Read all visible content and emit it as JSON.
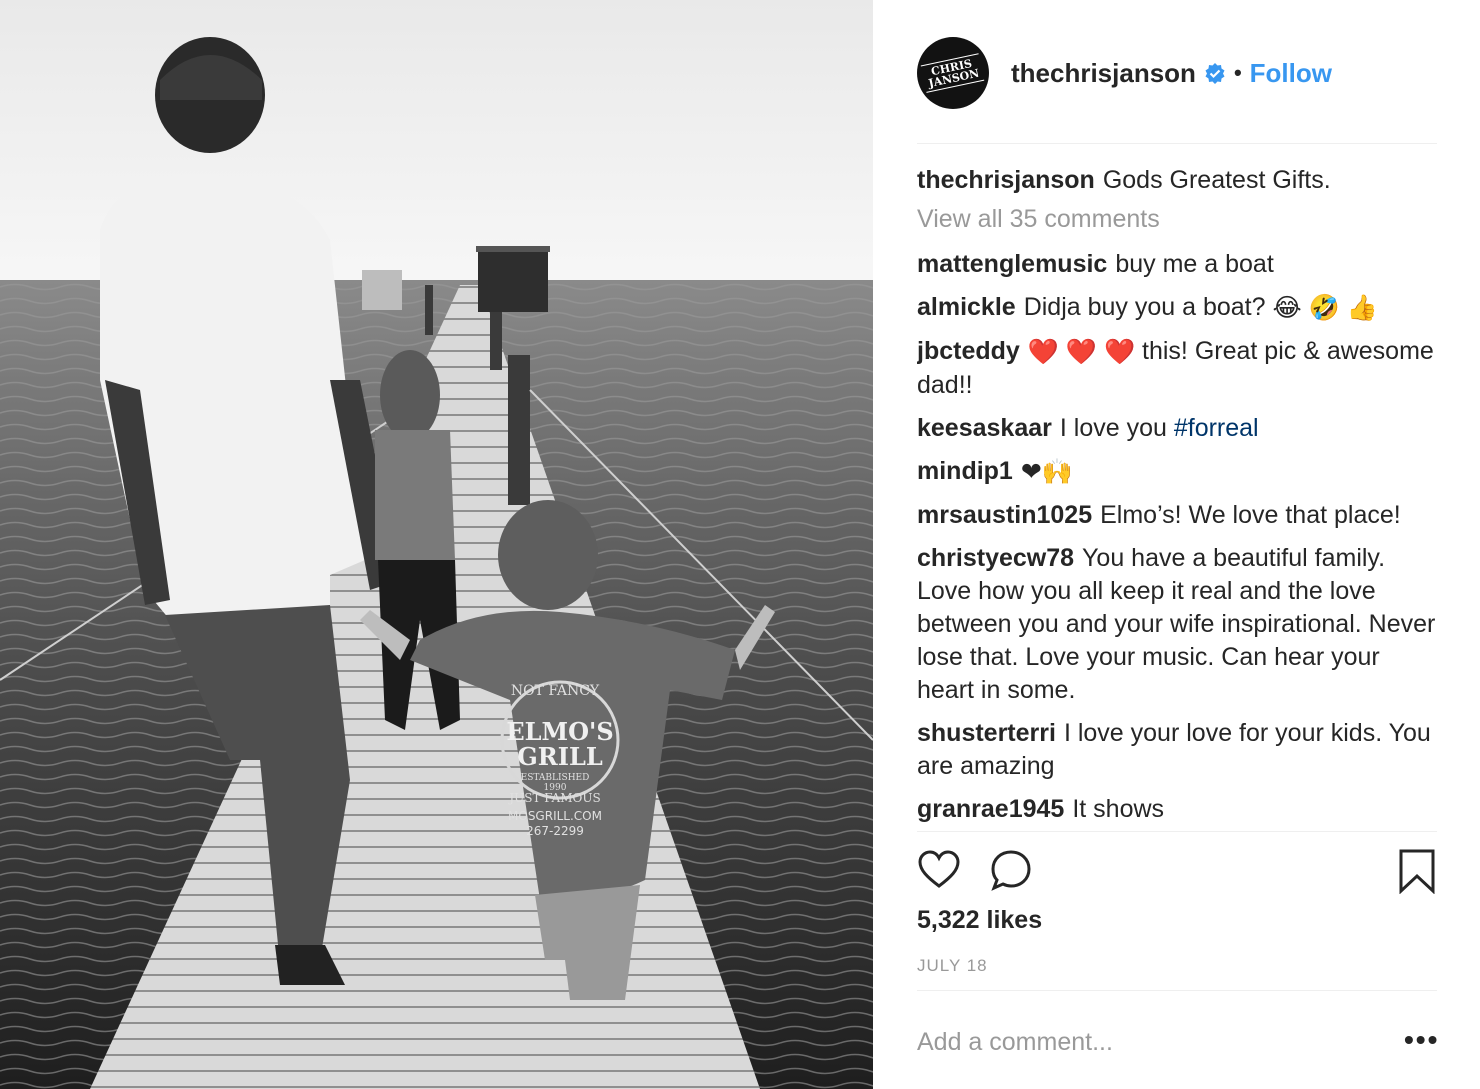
{
  "post": {
    "username": "thechrisjanson",
    "avatar_text_line1": "CHRIS",
    "avatar_text_line2": "JANSON",
    "verified_icon": "verified-badge-icon",
    "separator": "•",
    "follow_label": "Follow",
    "caption_user": "thechrisjanson",
    "caption_text": "Gods Greatest Gifts.",
    "view_all_label": "View all 35 comments",
    "likes": "5,322 likes",
    "date": "JULY 18",
    "add_comment_placeholder": "Add a comment...",
    "more_label": "•••",
    "shirt_text_1": "NOT FANCY",
    "shirt_text_2": "ELMO'S",
    "shirt_text_3": "GRILL",
    "shirt_text_4": "ESTABLISHED",
    "shirt_text_5": "1990",
    "shirt_text_6": "JUST FAMOUS",
    "shirt_text_7": "MOSGRILL.COM",
    "shirt_text_8": "267-2299"
  },
  "comments": [
    {
      "user": "mattenglemusic",
      "text": "buy me a boat"
    },
    {
      "user": "almickle",
      "text": "Didja buy you a boat?",
      "emoji": "😂 🤣 👍"
    },
    {
      "user": "jbcteddy",
      "emoji": "❤️ ❤️ ❤️",
      "text": " this! Great pic & awesome dad!!"
    },
    {
      "user": "keesaskaar",
      "text": "I love you",
      "hashtag": "#forreal"
    },
    {
      "user": "mindip1",
      "emoji": "❤🙌"
    },
    {
      "user": "mrsaustin1025",
      "text": "Elmo’s! We love that place!"
    },
    {
      "user": "christyecw78",
      "text": "You have a beautiful family. Love how you all keep it real and the love between you and your wife inspirational. Never lose that. Love your music. Can hear your heart in some."
    },
    {
      "user": "shusterterri",
      "text": "I love your love for your kids. You are amazing"
    },
    {
      "user": "granrae1945",
      "text": "It shows"
    }
  ],
  "icons": {
    "like": "heart-icon",
    "comment": "comment-bubble-icon",
    "save": "bookmark-icon"
  }
}
